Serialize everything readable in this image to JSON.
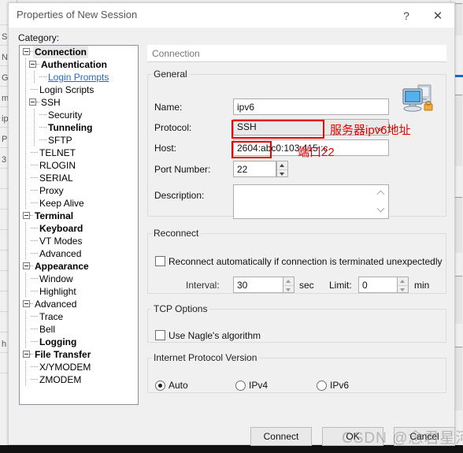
{
  "background": {
    "left_rows": [
      "",
      "S",
      "N",
      "Ge",
      "m",
      "ip",
      "P",
      "3",
      "",
      "",
      "",
      "",
      "",
      "",
      "",
      "",
      "h",
      ""
    ],
    "accent_color": "#1b6ac9"
  },
  "dialog": {
    "title": "Properties of New Session",
    "help_icon": "?",
    "close_icon": "✕",
    "category_label": "Category:"
  },
  "tree": {
    "items": [
      {
        "label": "Connection",
        "indent": 0,
        "bold": true,
        "selected": true,
        "expander": true,
        "link": false
      },
      {
        "label": "Authentication",
        "indent": 1,
        "bold": true,
        "selected": false,
        "expander": true,
        "link": false
      },
      {
        "label": "Login Prompts",
        "indent": 2,
        "bold": false,
        "selected": false,
        "expander": false,
        "link": true
      },
      {
        "label": "Login Scripts",
        "indent": 1,
        "bold": false,
        "selected": false,
        "expander": false,
        "link": false
      },
      {
        "label": "SSH",
        "indent": 1,
        "bold": false,
        "selected": false,
        "expander": true,
        "link": false
      },
      {
        "label": "Security",
        "indent": 2,
        "bold": false,
        "selected": false,
        "expander": false,
        "link": false
      },
      {
        "label": "Tunneling",
        "indent": 2,
        "bold": true,
        "selected": false,
        "expander": false,
        "link": false
      },
      {
        "label": "SFTP",
        "indent": 2,
        "bold": false,
        "selected": false,
        "expander": false,
        "link": false
      },
      {
        "label": "TELNET",
        "indent": 1,
        "bold": false,
        "selected": false,
        "expander": false,
        "link": false
      },
      {
        "label": "RLOGIN",
        "indent": 1,
        "bold": false,
        "selected": false,
        "expander": false,
        "link": false
      },
      {
        "label": "SERIAL",
        "indent": 1,
        "bold": false,
        "selected": false,
        "expander": false,
        "link": false
      },
      {
        "label": "Proxy",
        "indent": 1,
        "bold": false,
        "selected": false,
        "expander": false,
        "link": false
      },
      {
        "label": "Keep Alive",
        "indent": 1,
        "bold": false,
        "selected": false,
        "expander": false,
        "link": false
      },
      {
        "label": "Terminal",
        "indent": 0,
        "bold": true,
        "selected": false,
        "expander": true,
        "link": false
      },
      {
        "label": "Keyboard",
        "indent": 1,
        "bold": true,
        "selected": false,
        "expander": false,
        "link": false
      },
      {
        "label": "VT Modes",
        "indent": 1,
        "bold": false,
        "selected": false,
        "expander": false,
        "link": false
      },
      {
        "label": "Advanced",
        "indent": 1,
        "bold": false,
        "selected": false,
        "expander": false,
        "link": false
      },
      {
        "label": "Appearance",
        "indent": 0,
        "bold": true,
        "selected": false,
        "expander": true,
        "link": false
      },
      {
        "label": "Window",
        "indent": 1,
        "bold": false,
        "selected": false,
        "expander": false,
        "link": false
      },
      {
        "label": "Highlight",
        "indent": 1,
        "bold": false,
        "selected": false,
        "expander": false,
        "link": false
      },
      {
        "label": "Advanced",
        "indent": 0,
        "bold": false,
        "selected": false,
        "expander": true,
        "link": false
      },
      {
        "label": "Trace",
        "indent": 1,
        "bold": false,
        "selected": false,
        "expander": false,
        "link": false
      },
      {
        "label": "Bell",
        "indent": 1,
        "bold": false,
        "selected": false,
        "expander": false,
        "link": false
      },
      {
        "label": "Logging",
        "indent": 1,
        "bold": true,
        "selected": false,
        "expander": false,
        "link": false
      },
      {
        "label": "File Transfer",
        "indent": 0,
        "bold": true,
        "selected": false,
        "expander": true,
        "link": false
      },
      {
        "label": "X/YMODEM",
        "indent": 1,
        "bold": false,
        "selected": false,
        "expander": false,
        "link": false
      },
      {
        "label": "ZMODEM",
        "indent": 1,
        "bold": false,
        "selected": false,
        "expander": false,
        "link": false
      }
    ]
  },
  "pane": {
    "header": "Connection",
    "general": {
      "legend": "General",
      "name_label": "Name:",
      "name_value": "ipv6",
      "protocol_label": "Protocol:",
      "protocol_value": "SSH",
      "host_label": "Host:",
      "host_value": "2604:abc0:103:415::c",
      "port_label": "Port Number:",
      "port_value": "22",
      "description_label": "Description:",
      "description_value": "",
      "icon": "network-computer-icon"
    },
    "reconnect": {
      "legend": "Reconnect",
      "auto_label": "Reconnect automatically if connection is terminated unexpectedly",
      "auto_checked": false,
      "interval_label": "Interval:",
      "interval_value": "30",
      "interval_unit": "sec",
      "limit_label": "Limit:",
      "limit_value": "0",
      "limit_unit": "min"
    },
    "tcp": {
      "legend": "TCP Options",
      "nagle_label": "Use Nagle's algorithm",
      "nagle_checked": false
    },
    "ipversion": {
      "legend": "Internet Protocol Version",
      "options": [
        {
          "label": "Auto",
          "checked": true
        },
        {
          "label": "IPv4",
          "checked": false
        },
        {
          "label": "IPv6",
          "checked": false
        }
      ]
    }
  },
  "annotations": {
    "host_note": "服务器ipv6地址",
    "port_note": "端口22",
    "box_color": "#e60000"
  },
  "buttons": {
    "connect": "Connect",
    "ok": "OK",
    "cancel": "Cancel"
  },
  "watermark": "CSDN @念君星河"
}
